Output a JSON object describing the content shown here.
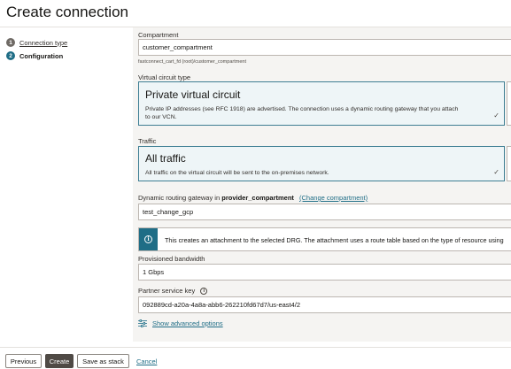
{
  "page": {
    "title": "Create connection"
  },
  "steps": [
    {
      "number": "1",
      "label": "Connection type"
    },
    {
      "number": "2",
      "label": "Configuration"
    }
  ],
  "compartment": {
    "label": "Compartment",
    "value": "customer_compartment",
    "hint": "fastconnect_cart_fd (root)/customer_compartment"
  },
  "virtual_circuit_type": {
    "label": "Virtual circuit type",
    "option_title": "Private virtual circuit",
    "option_desc_line1": "Private IP addresses (see RFC 1918) are advertised. The connection uses a dynamic routing gateway that you attach",
    "option_desc_line2": "to our VCN."
  },
  "traffic": {
    "label": "Traffic",
    "option_title": "All traffic",
    "option_desc": "All traffic on the virtual circuit will be sent to the on-premises network."
  },
  "drg": {
    "label_prefix": "Dynamic routing gateway in",
    "compartment_name": "provider_compartment",
    "change_link": "(Change compartment)",
    "value": "test_change_gcp"
  },
  "info_banner": {
    "text": "This creates an attachment to the selected DRG. The attachment uses a route table based on the type of resource using"
  },
  "bandwidth": {
    "label": "Provisioned bandwidth",
    "value": "1 Gbps"
  },
  "partner_key": {
    "label": "Partner service key",
    "value": "092889cd-a20a-4a8a-abb6-262210fd67d7/us-east4/2"
  },
  "advanced": {
    "label": "Show advanced options"
  },
  "footer": {
    "previous": "Previous",
    "create": "Create",
    "save_stack": "Save as stack",
    "cancel": "Cancel"
  },
  "colors": {
    "accent": "#1f6d86",
    "primary_button": "#4f4a45",
    "selected_card_bg": "#eef5f7"
  }
}
